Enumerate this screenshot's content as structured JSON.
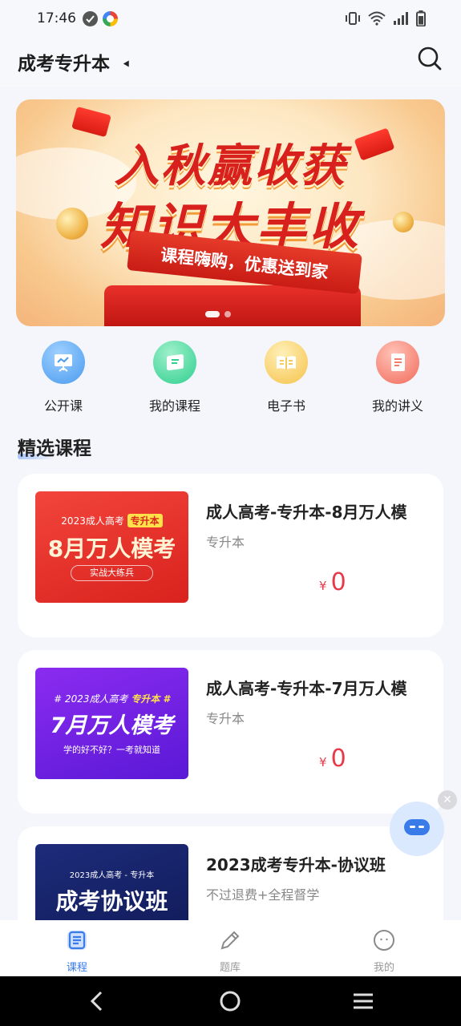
{
  "status_bar": {
    "time": "17:46"
  },
  "header": {
    "title": "成考专升本"
  },
  "banner": {
    "title_line1": "入秋赢收获",
    "title_line2": "知识大丰收",
    "ribbon": "课程嗨购，优惠送到家",
    "pager": {
      "count": 2,
      "active": 0
    }
  },
  "quick_nav": [
    {
      "label": "公开课",
      "icon": "presentation-icon",
      "color": "#4a9bef"
    },
    {
      "label": "我的课程",
      "icon": "ticket-icon",
      "color": "#2fcf8f"
    },
    {
      "label": "电子书",
      "icon": "book-icon",
      "color": "#f5c24a"
    },
    {
      "label": "我的讲义",
      "icon": "document-icon",
      "color": "#f26a5a"
    }
  ],
  "section": {
    "title": "精选课程"
  },
  "courses": [
    {
      "name": "成人高考-专升本-8月万人模",
      "tag": "专升本",
      "price_symbol": "¥",
      "price": "0",
      "thumb": {
        "line_top": "2023成人高考",
        "badge": "专升本",
        "big": "8月万人模考",
        "pill": "实战大练兵"
      }
    },
    {
      "name": "成人高考-专升本-7月万人模",
      "tag": "专升本",
      "price_symbol": "¥",
      "price": "0",
      "thumb": {
        "line_top": "# 2023成人高考",
        "badge": "专升本 #",
        "big": "7月万人模考",
        "sub": "学的好不好？一考就知道"
      }
    },
    {
      "name": "2023成考专升本-协议班",
      "tag": "不过退费+全程督学",
      "thumb": {
        "line_top": "2023成人高考 - 专升本",
        "big": "成考协议班"
      }
    }
  ],
  "tabbar": [
    {
      "label": "课程",
      "icon": "course-icon",
      "active": true
    },
    {
      "label": "题库",
      "icon": "pencil-icon",
      "active": false
    },
    {
      "label": "我的",
      "icon": "profile-icon",
      "active": false
    }
  ],
  "colors": {
    "accent": "#3a7bea",
    "price": "#e8394a",
    "banner_red": "#d8211c"
  }
}
